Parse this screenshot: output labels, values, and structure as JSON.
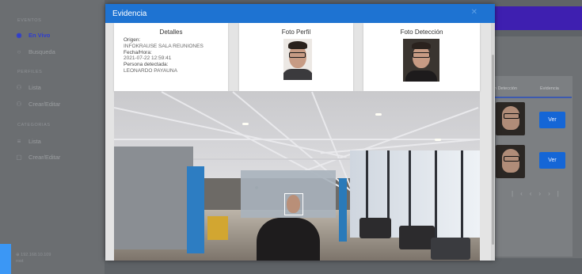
{
  "sidebar": {
    "sections": {
      "eventos": "EVENTOS",
      "perfiles": "PERFILES",
      "categorias": "CATEGORIAS"
    },
    "items": [
      {
        "label": "En Vivo",
        "icon": "eye-icon",
        "active": true
      },
      {
        "label": "Busqueda",
        "icon": "search-icon",
        "active": false
      },
      {
        "label": "Lista",
        "icon": "users-icon",
        "active": false
      },
      {
        "label": "Crear/Editar",
        "icon": "user-edit-icon",
        "active": false
      },
      {
        "label": "Lista",
        "icon": "list-icon",
        "active": false
      },
      {
        "label": "Crear/Editar",
        "icon": "edit-icon",
        "active": false
      }
    ],
    "footer": {
      "ip": "192.168.10.109",
      "user": "root"
    }
  },
  "background_table": {
    "headers": [
      "n Detección",
      "Evidencia"
    ],
    "ver_label": "Ver"
  },
  "modal": {
    "title": "Evidencia",
    "details": {
      "title": "Detalles",
      "origin_label": "Origen:",
      "origin_value": "INFOKRAUSE SALA REUNIONES",
      "datetime_label": "Fecha/Hora:",
      "datetime_value": "2021-07-22 12:59:41",
      "person_label": "Persona detectada:",
      "person_value": "LEONARDO PAYAUNA"
    },
    "profile_photo_title": "Foto Perfil",
    "detection_photo_title": "Foto Detección"
  },
  "colors": {
    "header_blue": "#1e73d2",
    "active_item": "#2f3dd0",
    "button_blue": "#1566d6",
    "pillar_blue": "#2d7dc2"
  }
}
